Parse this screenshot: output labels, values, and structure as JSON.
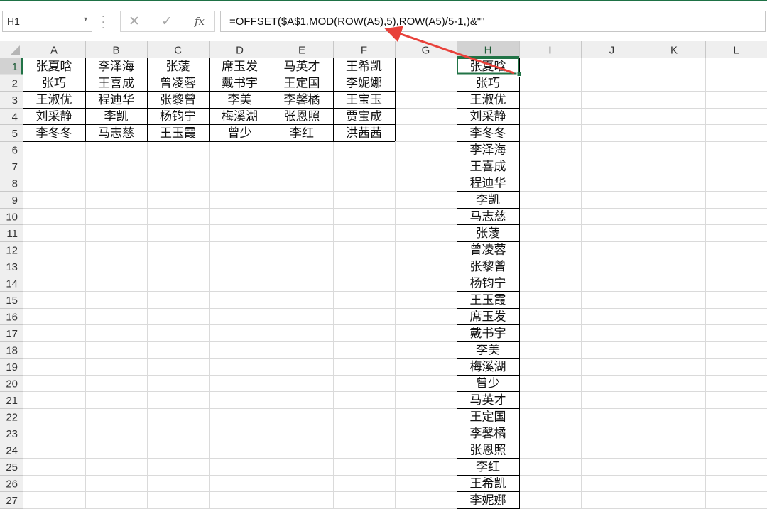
{
  "name_box": {
    "value": "H1",
    "dropdown_icon": "chevron-down-icon"
  },
  "toolbar": {
    "cancel_icon": "close-icon",
    "enter_icon": "check-icon",
    "fx_label": "fx"
  },
  "formula_bar": {
    "value": "=OFFSET($A$1,MOD(ROW(A5),5),ROW(A5)/5-1,)&\"\""
  },
  "columns": [
    "A",
    "B",
    "C",
    "D",
    "E",
    "F",
    "G",
    "H",
    "I",
    "J",
    "K",
    "L"
  ],
  "rows": [
    "1",
    "2",
    "3",
    "4",
    "5",
    "6",
    "7",
    "8",
    "9",
    "10",
    "11",
    "12",
    "13",
    "14",
    "15",
    "16",
    "17",
    "18",
    "19",
    "20",
    "21",
    "22",
    "23",
    "24",
    "25",
    "26",
    "27"
  ],
  "selected_cell": "H1",
  "colors": {
    "accent": "#1e7145",
    "selection": "#217346",
    "arrow": "#e8413a",
    "header_selected_bg": "#d2d2d2"
  },
  "source_table": [
    [
      "张夏晗",
      "李泽海",
      "张蓤",
      "席玉发",
      "马英才",
      "王希凯"
    ],
    [
      "张巧",
      "王喜成",
      "曾凌蓉",
      "戴书宇",
      "王定国",
      "李妮娜"
    ],
    [
      "王淑优",
      "程迪华",
      "张黎曾",
      "李美",
      "李馨橘",
      "王宝玉"
    ],
    [
      "刘采静",
      "李凯",
      "杨钧宁",
      "梅溪湖",
      "张恩照",
      "贾宝成"
    ],
    [
      "李冬冬",
      "马志慈",
      "王玉霞",
      "曾少",
      "李红",
      "洪茜茜"
    ]
  ],
  "result_column": [
    "张夏晗",
    "张巧",
    "王淑优",
    "刘采静",
    "李冬冬",
    "李泽海",
    "王喜成",
    "程迪华",
    "李凯",
    "马志慈",
    "张蓤",
    "曾凌蓉",
    "张黎曾",
    "杨钧宁",
    "王玉霞",
    "席玉发",
    "戴书宇",
    "李美",
    "梅溪湖",
    "曾少",
    "马英才",
    "王定国",
    "李馨橘",
    "张恩照",
    "李红",
    "王希凯",
    "李妮娜"
  ]
}
